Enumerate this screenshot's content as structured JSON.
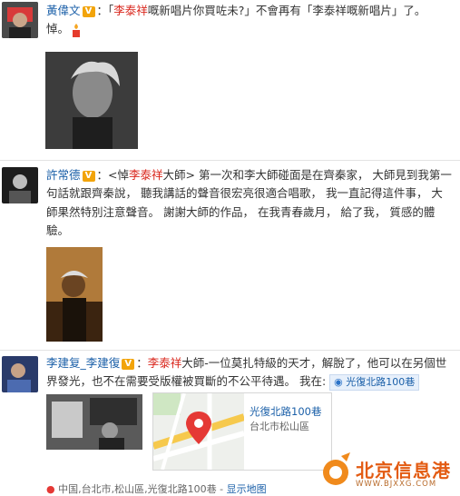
{
  "post1": {
    "user": "黃偉文",
    "line1_prefix": "：「",
    "line1_name": "李泰祥",
    "line1_suffix": "嘅新唱片你買咗未?」不會再有「李泰祥嘅新唱片」了。",
    "line2": "悼。"
  },
  "post2": {
    "user": "許常德",
    "line1_prefix": "：<悼",
    "line1_name": "李泰祥",
    "line1_suffix": "大師> 第一次和李大師碰面是在齊秦家， 大師見到我第一",
    "line2": "句話就跟齊秦說， 聽我講話的聲音很宏亮很適合唱歌， 我一直記得這件事， 大",
    "line3": "師果然特別注意聲音。 謝謝大師的作品， 在我青春歲月， 給了我， 質感的體",
    "line4": "驗。"
  },
  "post3": {
    "user": "李建复_李建復",
    "line1_prefix": "：",
    "line1_name": "李泰祥",
    "line1_suffix": "大師-一位莫扎特級的天才，解脫了，他可以在另個世",
    "line2_prefix": "界發光，也不在需要受版權被買斷的不公平待遇。 我在:",
    "location_chip": "光復北路100巷",
    "map_title": "光復北路100巷",
    "map_subtitle": "台北市松山區",
    "footer_location": "中国,台北市,松山區,光復北路100巷",
    "footer_sep": "-",
    "footer_link": "显示地图"
  },
  "watermark": {
    "name": "北京信息港",
    "url": "WWW.BJXXG.COM"
  }
}
